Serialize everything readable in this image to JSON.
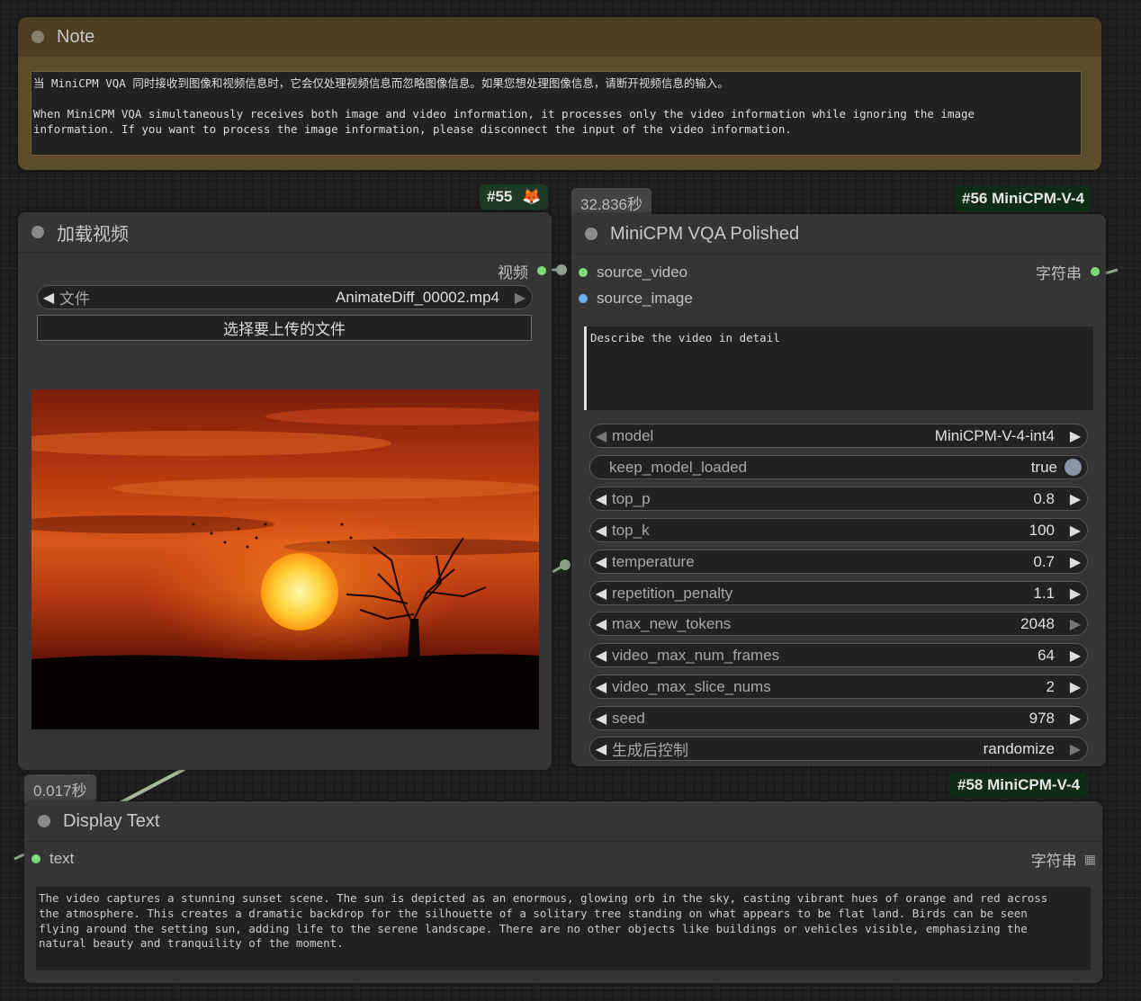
{
  "note": {
    "title": "Note",
    "text": "当 MiniCPM VQA 同时接收到图像和视频信息时，它会仅处理视频信息而忽略图像信息。如果您想处理图像信息，请断开视频信息的输入。\n\nWhen MiniCPM VQA simultaneously receives both image and video information, it processes only the video information while ignoring the image\ninformation. If you want to process the image information, please disconnect the input of the video information."
  },
  "load_video": {
    "badge": "#55",
    "badge_icon": "🦊",
    "title": "加载视频",
    "output_label": "视频",
    "file_widget": {
      "label": "文件",
      "value": "AnimateDiff_00002.mp4"
    },
    "upload_button": "选择要上传的文件",
    "preview_icon": "sunset-tree-image"
  },
  "vqa": {
    "timer": "32.836秒",
    "badge": "#56 MiniCPM-V-4",
    "title": "MiniCPM VQA Polished",
    "inputs": [
      {
        "label": "source_video",
        "color": "#7ddc7a"
      },
      {
        "label": "source_image",
        "color": "#6ab0f3"
      }
    ],
    "output_label": "字符串",
    "prompt": "Describe the video in detail",
    "widgets": [
      {
        "label": "model",
        "value": "MiniCPM-V-4-int4"
      },
      {
        "label": "keep_model_loaded",
        "value": "true"
      },
      {
        "label": "top_p",
        "value": "0.8"
      },
      {
        "label": "top_k",
        "value": "100"
      },
      {
        "label": "temperature",
        "value": "0.7"
      },
      {
        "label": "repetition_penalty",
        "value": "1.1"
      },
      {
        "label": "max_new_tokens",
        "value": "2048"
      },
      {
        "label": "video_max_num_frames",
        "value": "64"
      },
      {
        "label": "video_max_slice_nums",
        "value": "2"
      },
      {
        "label": "seed",
        "value": "978"
      },
      {
        "label": "生成后控制",
        "value": "randomize"
      }
    ]
  },
  "display": {
    "timer": "0.017秒",
    "badge": "#58 MiniCPM-V-4",
    "title": "Display Text",
    "input_label": "text",
    "output_label": "字符串",
    "text": "The video captures a stunning sunset scene. The sun is depicted as an enormous, glowing orb in the sky, casting vibrant hues of orange and red across\nthe atmosphere. This creates a dramatic backdrop for the silhouette of a solitary tree standing on what appears to be flat land. Birds can be seen\nflying around the setting sun, adding life to the serene landscape. There are no other objects like buildings or vehicles visible, emphasizing the\nnatural beauty and tranquility of the moment."
  }
}
